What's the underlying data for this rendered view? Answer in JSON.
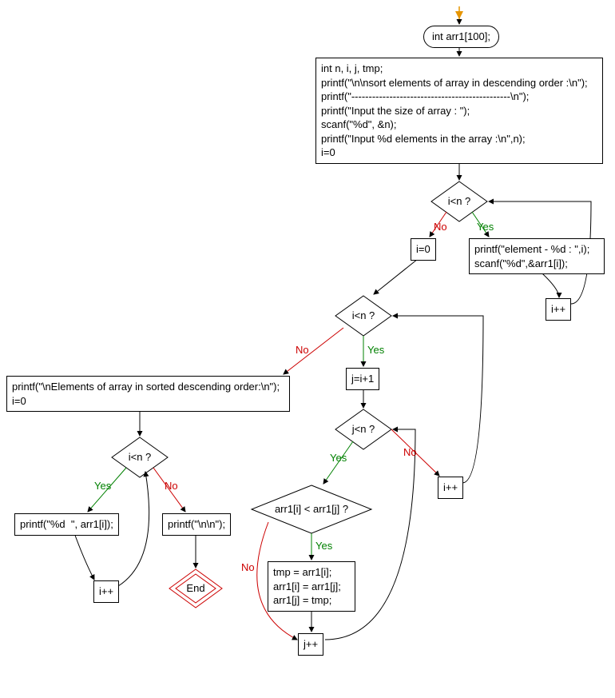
{
  "flowchart": {
    "title": "sort elements of array in descending order",
    "start_node": "int arr1[100];",
    "init_block": "int n, i, j, tmp;\nprintf(\"\\n\\nsort elements of array in descending order :\\n\");\nprintf(\"----------------------------------------------\\n\");\nprintf(\"Input the size of array : \");\nscanf(\"%d\", &n);\nprintf(\"Input %d elements in the array :\\n\",n);\ni=0",
    "cond1": "i<n ?",
    "cond1_yes_body": "printf(\"element - %d : \",i);\nscanf(\"%d\",&arr1[i]);",
    "cond1_inc": "i++",
    "reset_i": "i=0",
    "cond2": "i<n ?",
    "cond2_yes_init": "j=i+1",
    "cond3": "j<n ?",
    "cond3_no_inc": "i++",
    "cond4": "arr1[i] < arr1[j] ?",
    "cond4_yes_body": "tmp = arr1[i];\narr1[i] = arr1[j];\narr1[j] = tmp;",
    "cond4_inc": "j++",
    "print_header": "printf(\"\\nElements of array in sorted descending order:\\n\");\ni=0",
    "cond5": "i<n ?",
    "cond5_yes_body": "printf(\"%d  \", arr1[i]);",
    "cond5_inc": "i++",
    "cond5_no_body": "printf(\"\\n\\n\");",
    "end_node": "End",
    "labels": {
      "yes": "Yes",
      "no": "No"
    }
  }
}
